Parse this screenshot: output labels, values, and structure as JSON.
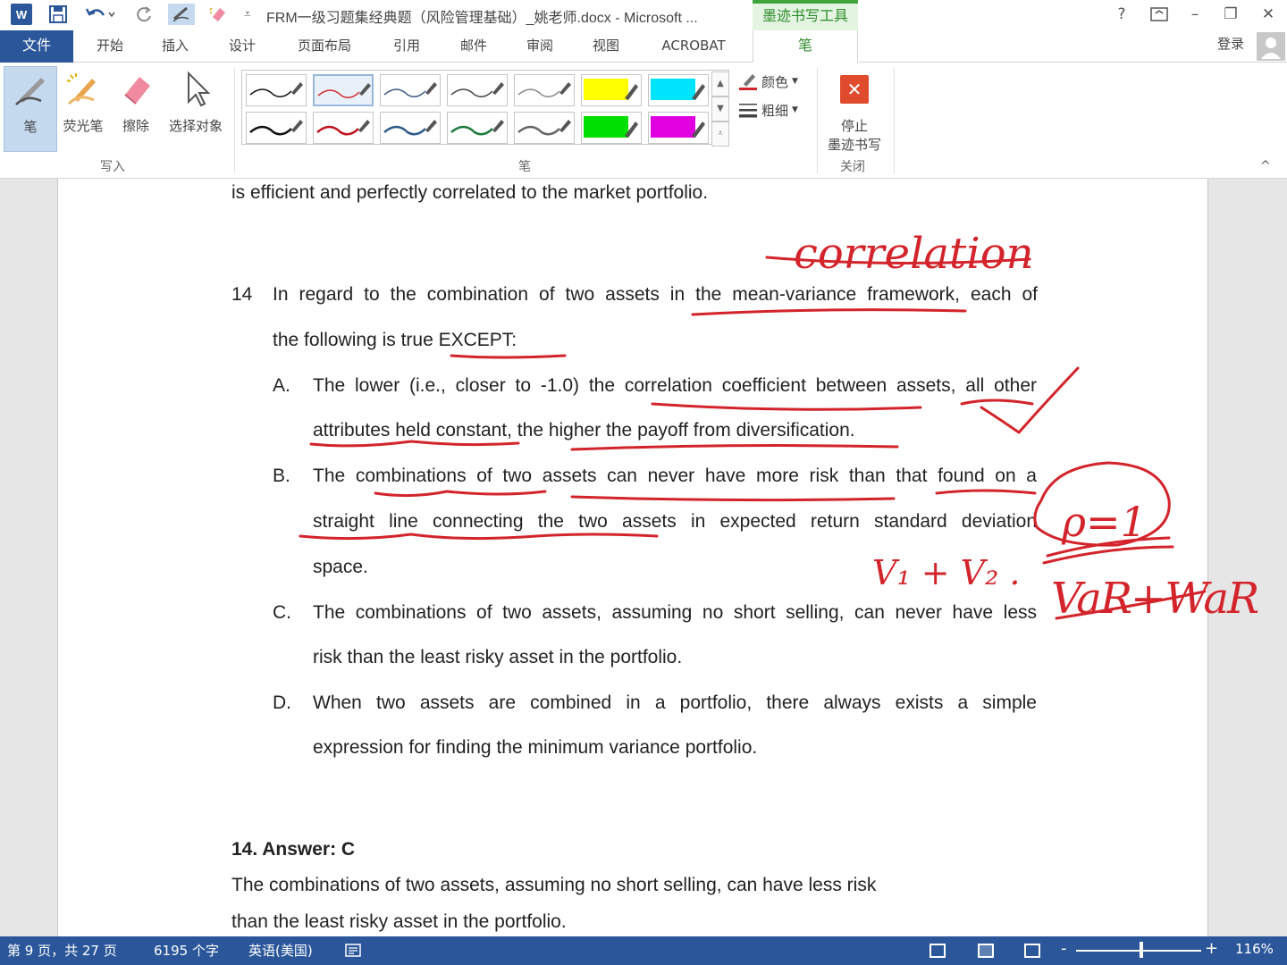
{
  "titlebar": {
    "app_logo": "W",
    "doc_title": "FRM一级习题集经典题（风险管理基础）_姚老师.docx - Microsoft ...",
    "contextual_tab_title": "墨迹书写工具",
    "help": "?",
    "minimize": "–",
    "restore": "❐",
    "close": "✕"
  },
  "tabs": {
    "file": "文件",
    "items": [
      "开始",
      "插入",
      "设计",
      "页面布局",
      "引用",
      "邮件",
      "审阅",
      "视图",
      "ACROBAT"
    ],
    "active": "笔",
    "login": "登录"
  },
  "ribbon": {
    "write_group": {
      "label": "写入",
      "pen": "笔",
      "highlighter": "荧光笔",
      "eraser": "擦除",
      "select": "选择对象"
    },
    "pens_group": {
      "label": "笔",
      "color": "颜色",
      "thickness": "粗细",
      "pen_colors": [
        "#111111",
        "#d22b2b",
        "#3a5a80",
        "#444444",
        "#888888",
        "#ffff00",
        "#00e5ff",
        "#111111",
        "#c0141d",
        "#2e5b88",
        "#1b7b3a",
        "#666666",
        "#00e000",
        "#e000e0"
      ]
    },
    "close_group": {
      "label": "关闭",
      "stop_line1": "停止",
      "stop_line2": "墨迹书写"
    },
    "collapse": "^"
  },
  "document": {
    "line0": "is efficient and perfectly correlated to the market portfolio.",
    "q_number": "14",
    "q_line1": "In regard to the combination of two assets in the mean-variance framework, each of",
    "q_line2": "the following is true EXCEPT:",
    "options": [
      {
        "letter": "A.",
        "lines": [
          "The lower (i.e., closer to -1.0) the correlation coefficient between assets, all other",
          "attributes held constant, the higher the payoff from diversification."
        ]
      },
      {
        "letter": "B.",
        "lines": [
          "The combinations of two assets can never have more risk than that found on a",
          "straight line connecting the two assets in expected return standard deviation",
          "space."
        ]
      },
      {
        "letter": "C.",
        "lines": [
          "The combinations of two assets, assuming no short selling, can never have less",
          "risk than the least risky asset in the portfolio."
        ]
      },
      {
        "letter": "D.",
        "lines": [
          "When two assets are combined in a portfolio, there always exists a simple",
          "expression for finding the minimum variance portfolio."
        ]
      }
    ],
    "answer_title": "14.  Answer: C",
    "answer_line1": "The combinations of two assets, assuming no short selling, can have less risk",
    "answer_line2": "than the least risky asset in the portfolio."
  },
  "ink": {
    "color": "#d3242b",
    "note_correlation": "correlation",
    "note_rho": "ρ=1",
    "note_v": "V₁ + V₂ .",
    "note_var": "VaR+WaR"
  },
  "statusbar": {
    "page": "第 9 页，共 27 页",
    "words": "6195 个字",
    "language": "英语(美国)",
    "zoom_minus": "-",
    "zoom_plus": "+",
    "zoom": "116%",
    "zoom_level": 0.52
  }
}
